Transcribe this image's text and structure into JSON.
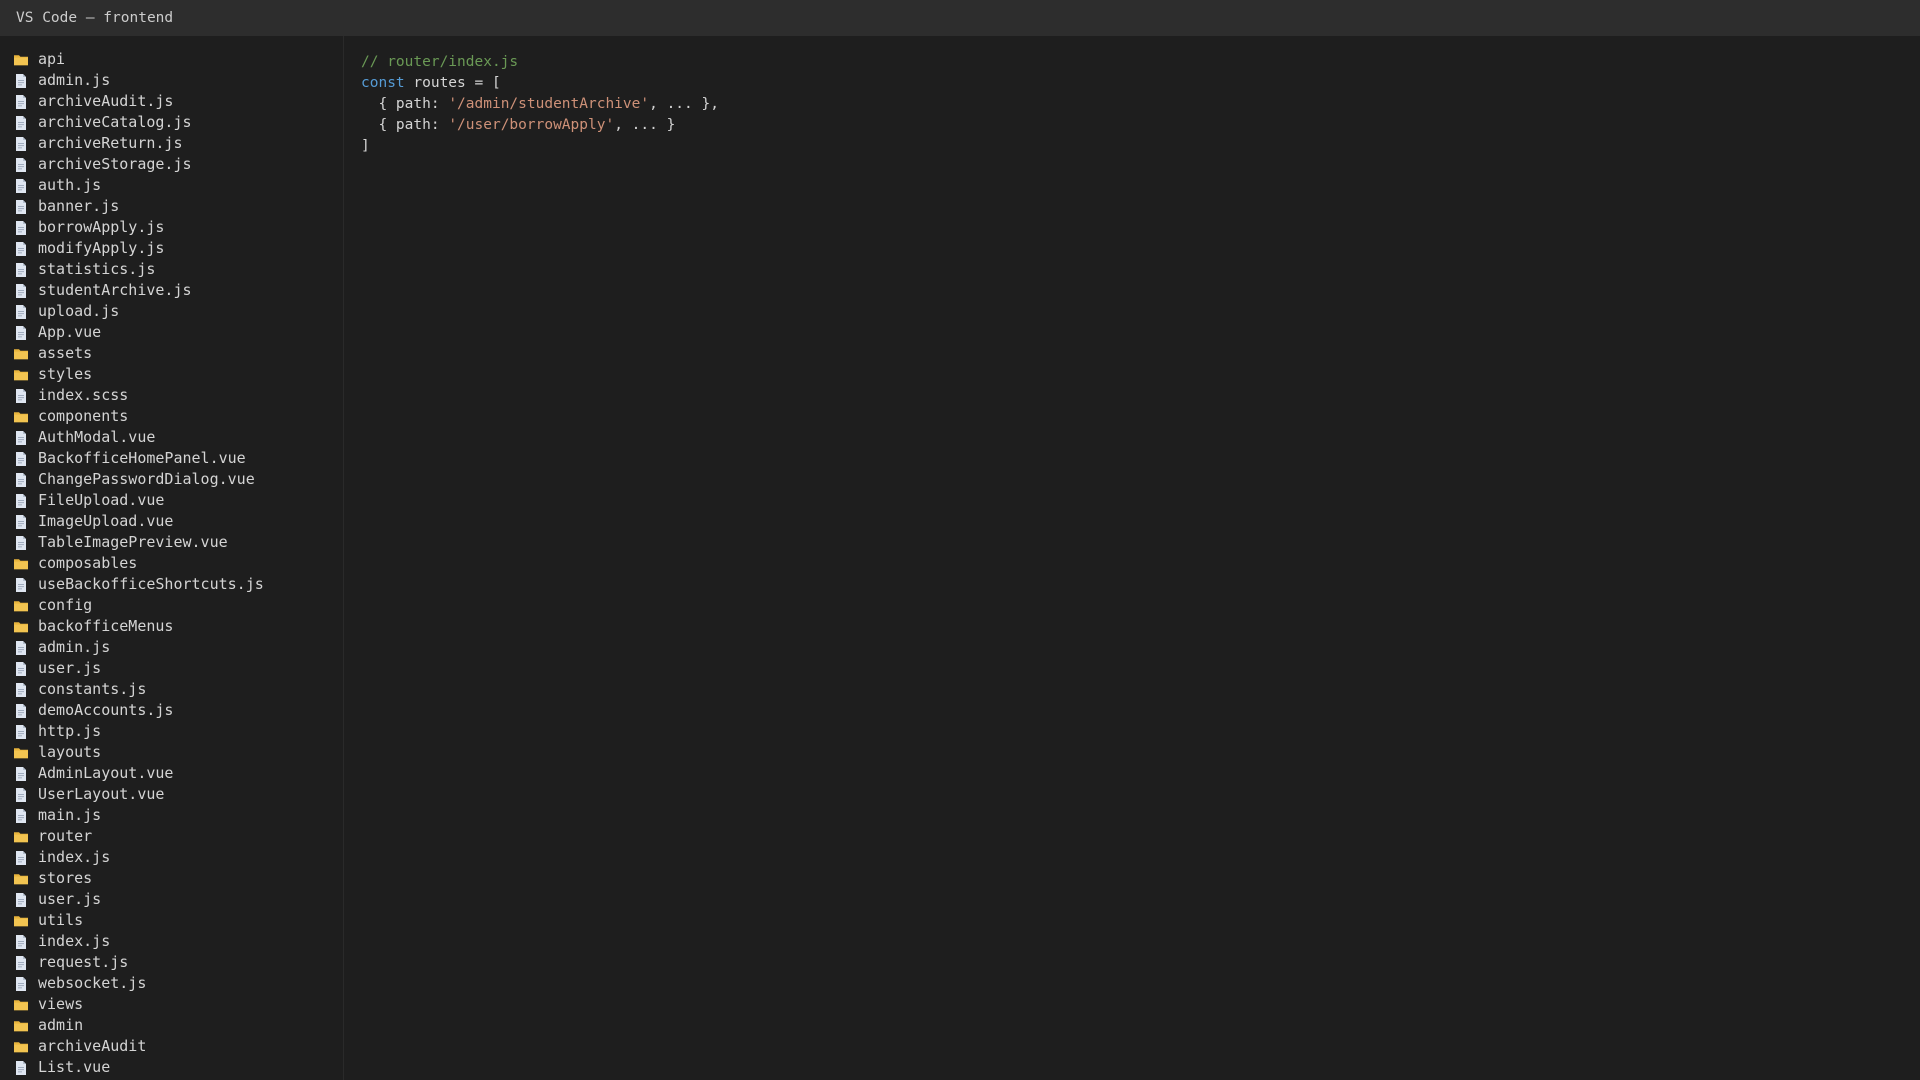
{
  "window": {
    "title": "VS Code — frontend"
  },
  "colors": {
    "background": "#1e1e1e",
    "titlebar": "#2d2d2d",
    "folder": "#e8b43c",
    "file": "#dfe6f1",
    "comment": "#6a9955",
    "keyword": "#569cd6",
    "string": "#ce9178",
    "text": "#d4d4d4"
  },
  "explorer": {
    "items": [
      {
        "type": "folder",
        "icon": "folder-icon",
        "label": "api"
      },
      {
        "type": "file",
        "icon": "file-icon",
        "label": "admin.js"
      },
      {
        "type": "file",
        "icon": "file-icon",
        "label": "archiveAudit.js"
      },
      {
        "type": "file",
        "icon": "file-icon",
        "label": "archiveCatalog.js"
      },
      {
        "type": "file",
        "icon": "file-icon",
        "label": "archiveReturn.js"
      },
      {
        "type": "file",
        "icon": "file-icon",
        "label": "archiveStorage.js"
      },
      {
        "type": "file",
        "icon": "file-icon",
        "label": "auth.js"
      },
      {
        "type": "file",
        "icon": "file-icon",
        "label": "banner.js"
      },
      {
        "type": "file",
        "icon": "file-icon",
        "label": "borrowApply.js"
      },
      {
        "type": "file",
        "icon": "file-icon",
        "label": "modifyApply.js"
      },
      {
        "type": "file",
        "icon": "file-icon",
        "label": "statistics.js"
      },
      {
        "type": "file",
        "icon": "file-icon",
        "label": "studentArchive.js"
      },
      {
        "type": "file",
        "icon": "file-icon",
        "label": "upload.js"
      },
      {
        "type": "file",
        "icon": "file-icon",
        "label": "App.vue"
      },
      {
        "type": "folder",
        "icon": "folder-icon",
        "label": "assets"
      },
      {
        "type": "folder",
        "icon": "folder-icon",
        "label": "styles"
      },
      {
        "type": "file",
        "icon": "file-icon",
        "label": "index.scss"
      },
      {
        "type": "folder",
        "icon": "folder-icon",
        "label": "components"
      },
      {
        "type": "file",
        "icon": "file-icon",
        "label": "AuthModal.vue"
      },
      {
        "type": "file",
        "icon": "file-icon",
        "label": "BackofficeHomePanel.vue"
      },
      {
        "type": "file",
        "icon": "file-icon",
        "label": "ChangePasswordDialog.vue"
      },
      {
        "type": "file",
        "icon": "file-icon",
        "label": "FileUpload.vue"
      },
      {
        "type": "file",
        "icon": "file-icon",
        "label": "ImageUpload.vue"
      },
      {
        "type": "file",
        "icon": "file-icon",
        "label": "TableImagePreview.vue"
      },
      {
        "type": "folder",
        "icon": "folder-icon",
        "label": "composables"
      },
      {
        "type": "file",
        "icon": "file-icon",
        "label": "useBackofficeShortcuts.js"
      },
      {
        "type": "folder",
        "icon": "folder-icon",
        "label": "config"
      },
      {
        "type": "folder",
        "icon": "folder-icon",
        "label": "backofficeMenus"
      },
      {
        "type": "file",
        "icon": "file-icon",
        "label": "admin.js"
      },
      {
        "type": "file",
        "icon": "file-icon",
        "label": "user.js"
      },
      {
        "type": "file",
        "icon": "file-icon",
        "label": "constants.js"
      },
      {
        "type": "file",
        "icon": "file-icon",
        "label": "demoAccounts.js"
      },
      {
        "type": "file",
        "icon": "file-icon",
        "label": "http.js"
      },
      {
        "type": "folder",
        "icon": "folder-icon",
        "label": "layouts"
      },
      {
        "type": "file",
        "icon": "file-icon",
        "label": "AdminLayout.vue"
      },
      {
        "type": "file",
        "icon": "file-icon",
        "label": "UserLayout.vue"
      },
      {
        "type": "file",
        "icon": "file-icon",
        "label": "main.js"
      },
      {
        "type": "folder",
        "icon": "folder-icon",
        "label": "router"
      },
      {
        "type": "file",
        "icon": "file-icon",
        "label": "index.js"
      },
      {
        "type": "folder",
        "icon": "folder-icon",
        "label": "stores"
      },
      {
        "type": "file",
        "icon": "file-icon",
        "label": "user.js"
      },
      {
        "type": "folder",
        "icon": "folder-icon",
        "label": "utils"
      },
      {
        "type": "file",
        "icon": "file-icon",
        "label": "index.js"
      },
      {
        "type": "file",
        "icon": "file-icon",
        "label": "request.js"
      },
      {
        "type": "file",
        "icon": "file-icon",
        "label": "websocket.js"
      },
      {
        "type": "folder",
        "icon": "folder-icon",
        "label": "views"
      },
      {
        "type": "folder",
        "icon": "folder-icon",
        "label": "admin"
      },
      {
        "type": "folder",
        "icon": "folder-icon",
        "label": "archiveAudit"
      },
      {
        "type": "file",
        "icon": "file-icon",
        "label": "List.vue"
      }
    ]
  },
  "editor": {
    "lines": [
      [
        {
          "kind": "comment",
          "text": "// router/index.js"
        }
      ],
      [
        {
          "kind": "keyword",
          "text": "const"
        },
        {
          "kind": "plain",
          "text": " routes = ["
        }
      ],
      [
        {
          "kind": "plain",
          "text": "  { path: "
        },
        {
          "kind": "string",
          "text": "'/admin/studentArchive'"
        },
        {
          "kind": "plain",
          "text": ", ... },"
        }
      ],
      [
        {
          "kind": "plain",
          "text": "  { path: "
        },
        {
          "kind": "string",
          "text": "'/user/borrowApply'"
        },
        {
          "kind": "plain",
          "text": ", ... }"
        }
      ],
      [
        {
          "kind": "plain",
          "text": "]"
        }
      ]
    ]
  }
}
